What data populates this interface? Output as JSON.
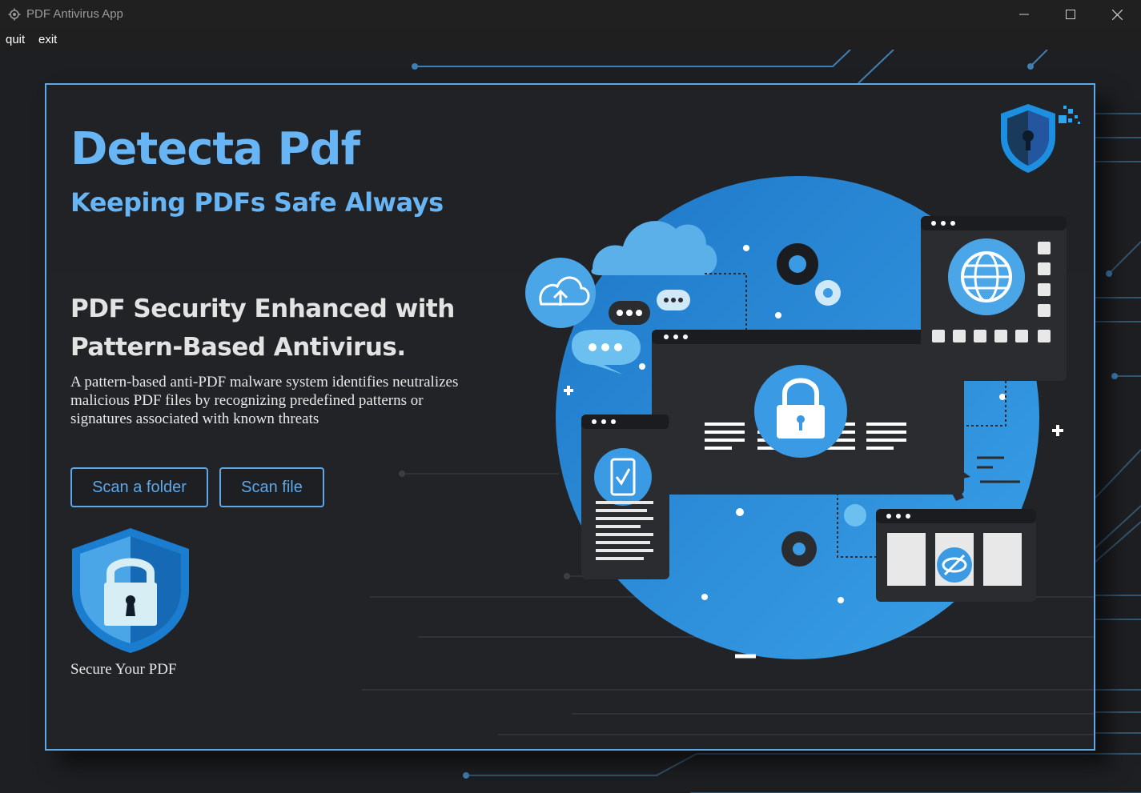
{
  "window": {
    "title": "PDF Antivirus App",
    "icon": "gear-app-icon",
    "controls": [
      "minimize-icon",
      "maximize-icon",
      "close-icon"
    ]
  },
  "menu": {
    "quit": "quit",
    "exit": "exit"
  },
  "hero": {
    "brand": "Detecta Pdf",
    "tagline": "Keeping PDFs Safe Always",
    "headline": "PDF Security Enhanced with Pattern-Based Antivirus.",
    "description": "A pattern-based anti-PDF malware system identifies neutralizes malicious PDF files by recognizing predefined patterns or signatures associated with known threats"
  },
  "actions": {
    "scan_folder": "Scan a folder",
    "scan_file": "Scan file"
  },
  "badge": {
    "label": "Secure Your PDF",
    "icon": "shield-lock-icon"
  },
  "colors": {
    "accent": "#5ea8e8",
    "brand": "#67b5f5",
    "background": "#1e1f22",
    "card": "#222326"
  }
}
